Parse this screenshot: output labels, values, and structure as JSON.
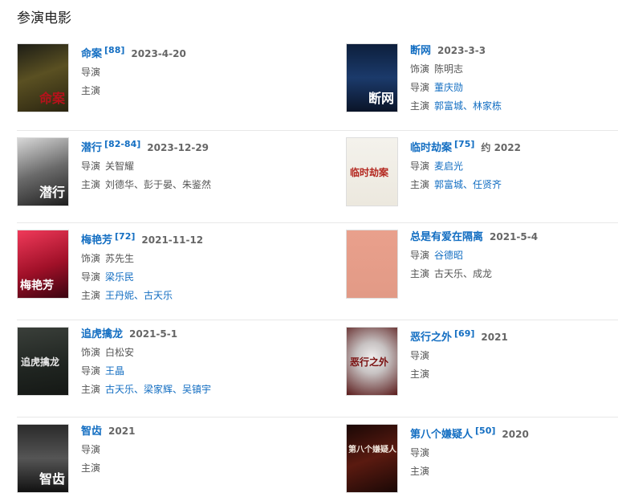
{
  "section_title": "参演电影",
  "films": [
    {
      "title": "命案",
      "ref": "[88]",
      "date": "2023-4-20",
      "roles": [
        {
          "label": "导演",
          "names": "",
          "link": false
        },
        {
          "label": "主演",
          "names": "",
          "link": false
        }
      ]
    },
    {
      "title": "断网",
      "ref": "",
      "date": "2023-3-3",
      "roles": [
        {
          "label": "饰演",
          "names": "陈明志",
          "link": false
        },
        {
          "label": "导演",
          "names": "董庆勋",
          "link": true
        },
        {
          "label": "主演",
          "names": "郭富城、林家栋",
          "link": true
        }
      ]
    },
    {
      "title": "潜行",
      "ref": "[82-84]",
      "date": "2023-12-29",
      "roles": [
        {
          "label": "导演",
          "names": "关智耀",
          "link": false
        },
        {
          "label": "主演",
          "names": "刘德华、彭于晏、朱鉴然",
          "link": false
        }
      ]
    },
    {
      "title": "临时劫案",
      "ref": "[75]",
      "date": "约 2022",
      "roles": [
        {
          "label": "导演",
          "names": "麦启光",
          "link": true
        },
        {
          "label": "主演",
          "names": "郭富城、任贤齐",
          "link": true
        }
      ]
    },
    {
      "title": "梅艳芳",
      "ref": "[72]",
      "date": "2021-11-12",
      "roles": [
        {
          "label": "饰演",
          "names": "苏先生",
          "link": false
        },
        {
          "label": "导演",
          "names": "梁乐民",
          "link": true
        },
        {
          "label": "主演",
          "names": "王丹妮、古天乐",
          "link": true
        }
      ]
    },
    {
      "title": "总是有爱在隔离",
      "ref": "",
      "date": "2021-5-4",
      "roles": [
        {
          "label": "导演",
          "names": "谷德昭",
          "link": true
        },
        {
          "label": "主演",
          "names": "古天乐、成龙",
          "link": false
        }
      ]
    },
    {
      "title": "追虎擒龙",
      "ref": "",
      "date": "2021-5-1",
      "roles": [
        {
          "label": "饰演",
          "names": "白松安",
          "link": false
        },
        {
          "label": "导演",
          "names": "王晶",
          "link": true
        },
        {
          "label": "主演",
          "names": "古天乐、梁家辉、吴镇宇",
          "link": true
        }
      ]
    },
    {
      "title": "恶行之外",
      "ref": "[69]",
      "date": "2021",
      "roles": [
        {
          "label": "导演",
          "names": "",
          "link": false
        },
        {
          "label": "主演",
          "names": "",
          "link": false
        }
      ]
    },
    {
      "title": "智齿",
      "ref": "",
      "date": "2021",
      "roles": [
        {
          "label": "导演",
          "names": "",
          "link": false
        },
        {
          "label": "主演",
          "names": "",
          "link": false
        }
      ]
    },
    {
      "title": "第八个嫌疑人",
      "ref": "[50]",
      "date": "2020",
      "roles": [
        {
          "label": "导演",
          "names": "",
          "link": false
        },
        {
          "label": "主演",
          "names": "",
          "link": false
        }
      ]
    }
  ],
  "posters": [
    {
      "bg": "linear-gradient(160deg,#1d1d16 0%,#5a5022 45%,#2a2410 100%)",
      "text": "命案",
      "color": "#b5121b"
    },
    {
      "bg": "linear-gradient(180deg,#0d1f3c 0%,#1b3a6b 50%,#0a1428 100%)",
      "text": "断网",
      "color": "#ffffff"
    },
    {
      "bg": "linear-gradient(160deg,#d8d8d8 0%,#6a6a6a 50%,#1e1e1e 100%)",
      "text": "潜行",
      "color": "#ffffff"
    },
    {
      "bg": "linear-gradient(180deg,#f4f2ec 0%,#ece8de 100%)",
      "text": "临时劫案",
      "color": "#b3261e"
    },
    {
      "bg": "linear-gradient(160deg,#f03a5a 0%,#a01028 55%,#3a0410 100%)",
      "text": "梅艳芳",
      "color": "#ffffff"
    },
    {
      "bg": "linear-gradient(180deg,#e9a08c 0%,#e29a86 100%)",
      "text": "",
      "color": "#ffffff"
    },
    {
      "bg": "linear-gradient(170deg,#3a3f3a 0%,#1f2420 60%,#151815 100%)",
      "text": "追虎擒龙",
      "color": "#e6e6e6"
    },
    {
      "bg": "radial-gradient(circle at 50% 45%,#f0eeee 0%,#c7c2c2 35%,#5a1a1a 100%)",
      "text": "恶行之外",
      "color": "#7a0f0f"
    },
    {
      "bg": "linear-gradient(180deg,#2a2a2a 0%,#555555 50%,#111111 100%)",
      "text": "智齿",
      "color": "#ffffff"
    },
    {
      "bg": "linear-gradient(160deg,#1a0806 0%,#5a1a10 50%,#1a0806 100%)",
      "text": "第八个嫌疑人",
      "color": "#f0e6dc"
    }
  ]
}
